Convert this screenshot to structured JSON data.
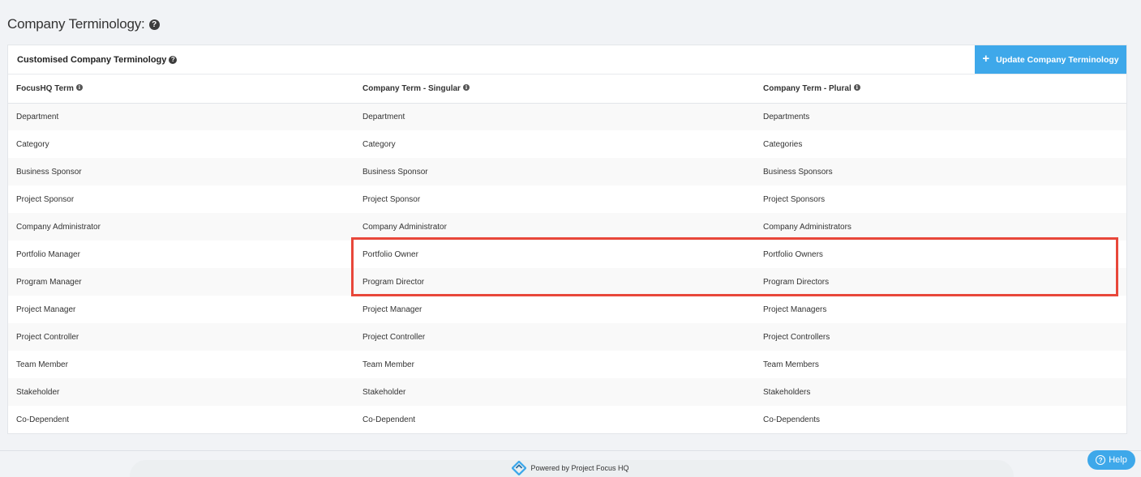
{
  "page": {
    "title": "Company Terminology:"
  },
  "panel": {
    "title": "Customised Company Terminology",
    "update_button": "Update Company Terminology"
  },
  "table": {
    "headers": [
      "FocusHQ Term",
      "Company Term - Singular",
      "Company Term - Plural"
    ],
    "rows": [
      [
        "Department",
        "Department",
        "Departments"
      ],
      [
        "Category",
        "Category",
        "Categories"
      ],
      [
        "Business Sponsor",
        "Business Sponsor",
        "Business Sponsors"
      ],
      [
        "Project Sponsor",
        "Project Sponsor",
        "Project Sponsors"
      ],
      [
        "Company Administrator",
        "Company Administrator",
        "Company Administrators"
      ],
      [
        "Portfolio Manager",
        "Portfolio Owner",
        "Portfolio Owners"
      ],
      [
        "Program Manager",
        "Program Director",
        "Program Directors"
      ],
      [
        "Project Manager",
        "Project Manager",
        "Project Managers"
      ],
      [
        "Project Controller",
        "Project Controller",
        "Project Controllers"
      ],
      [
        "Team Member",
        "Team Member",
        "Team Members"
      ],
      [
        "Stakeholder",
        "Stakeholder",
        "Stakeholders"
      ],
      [
        "Co-Dependent",
        "Co-Dependent",
        "Co-Dependents"
      ]
    ]
  },
  "footer": {
    "powered_by": "Powered by Project Focus HQ"
  },
  "help": {
    "label": "Help"
  },
  "colors": {
    "accent": "#3ea8ea",
    "highlight": "#e8473a",
    "background": "#f1f3f6"
  }
}
